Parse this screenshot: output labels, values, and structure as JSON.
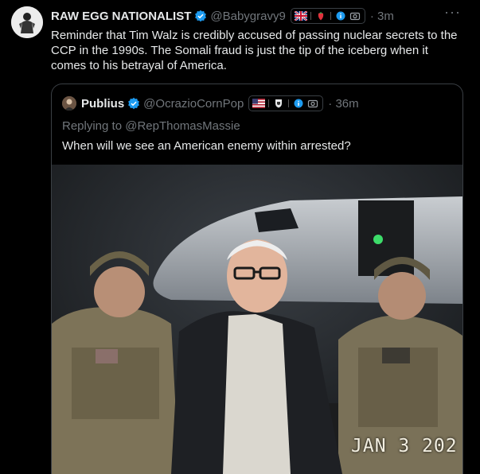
{
  "tweet": {
    "author_name": "RAW EGG NATIONALIST",
    "handle": "@Babygravy9",
    "time": "· 3m",
    "more": "···",
    "text": "Reminder that Tim Walz is credibly accused of passing nuclear secrets to the CCP in the 1990s. The Somali fraud is just the tip of the iceberg when it comes to his betrayal of America.",
    "badge_icons": [
      "uk-flag-icon",
      "strawberry-icon",
      "info-icon",
      "camera-icon"
    ]
  },
  "quote": {
    "author_name": "Publius",
    "handle": "@OcrazioCornPop",
    "time": "· 36m",
    "replying_prefix": "Replying to ",
    "replying_to": "@RepThomasMassie",
    "text": "When will we see an American enemy within arrested?",
    "badge_icons": [
      "us-flag-icon",
      "shield-icon",
      "info-icon",
      "camera-icon"
    ],
    "photo": {
      "date_stamp": "JAN 3 202"
    }
  },
  "colors": {
    "background": "#000000",
    "text": "#e7e9ea",
    "secondary": "#71767b",
    "verified": "#1d9bf0",
    "border": "#3a3f44"
  }
}
